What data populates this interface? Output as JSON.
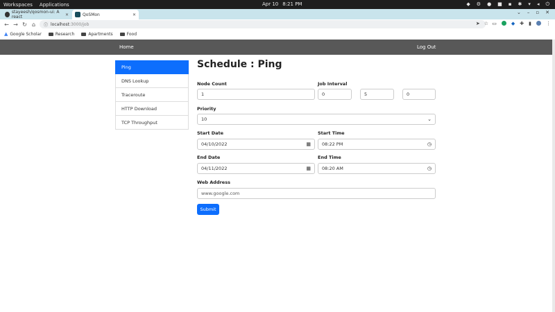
{
  "os": {
    "workspaces": "Workspaces",
    "applications": "Applications",
    "date": "Apr 10",
    "time": "8:21 PM"
  },
  "browser": {
    "tabs": [
      {
        "label": "stayeesh/qosmon-ui: A react",
        "active": false
      },
      {
        "label": "QoSMon",
        "active": true
      }
    ],
    "url_host": "localhost",
    "url_path": ":3000/job"
  },
  "bookmarks": [
    "Google Scholar",
    "Research",
    "Apartments",
    "Food"
  ],
  "app_nav": {
    "home": "Home",
    "logout": "Log Out"
  },
  "sidebar": {
    "items": [
      {
        "label": "Ping",
        "active": true
      },
      {
        "label": "DNS Lookup",
        "active": false
      },
      {
        "label": "Traceroute",
        "active": false
      },
      {
        "label": "HTTP Download",
        "active": false
      },
      {
        "label": "TCP Throughput",
        "active": false
      }
    ]
  },
  "form": {
    "title": "Schedule : Ping",
    "node_count_label": "Node Count",
    "node_count_value": "1",
    "job_interval_label": "Job Interval",
    "job_interval_values": [
      "0",
      "5",
      "0"
    ],
    "priority_label": "Priority",
    "priority_value": "10",
    "start_date_label": "Start Date",
    "start_date_value": "04/10/2022",
    "start_time_label": "Start Time",
    "start_time_value": "08:22 PM",
    "end_date_label": "End Date",
    "end_date_value": "04/11/2022",
    "end_time_label": "End Time",
    "end_time_value": "08:20 AM",
    "web_address_label": "Web Address",
    "web_address_placeholder": "www.google.com",
    "submit_label": "Submit"
  },
  "colors": {
    "accent": "#0d6efd",
    "navbar": "#585858",
    "tab_strip": "#c9e4ec"
  }
}
